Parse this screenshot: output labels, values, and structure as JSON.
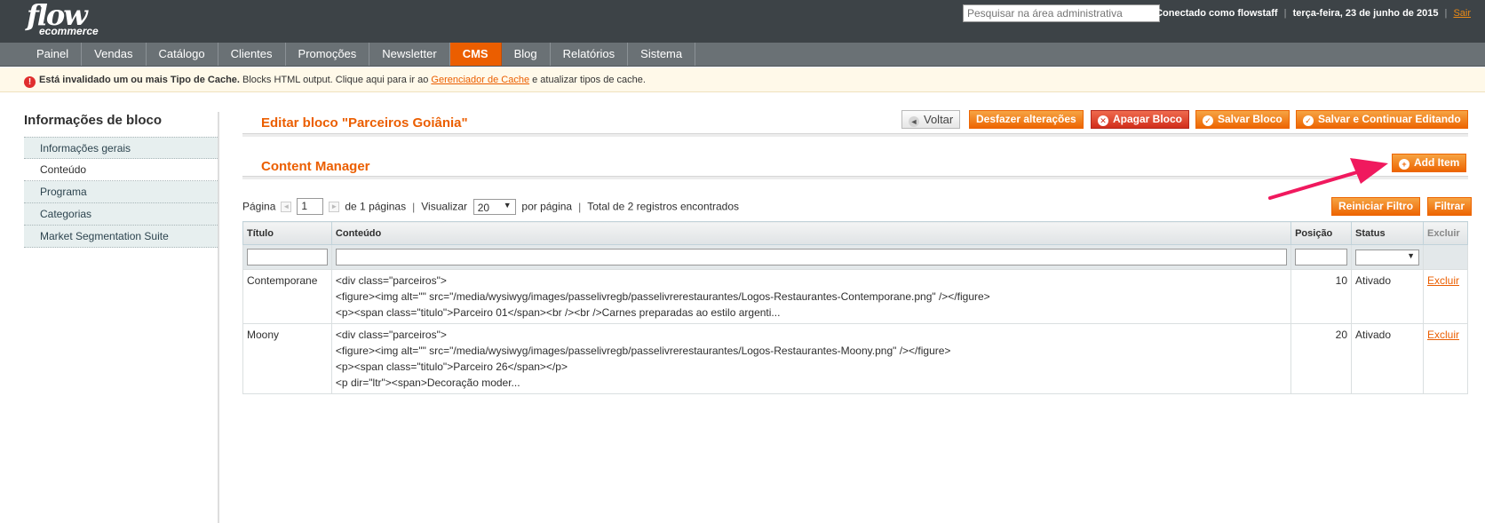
{
  "header": {
    "logo_line1": "flow",
    "logo_line2": "ecommerce",
    "search_placeholder": "Pesquisar na área administrativa",
    "logged_in": "Conectado como flowstaff",
    "date": "terça-feira, 23 de junho de 2015",
    "separator": "|",
    "logout": "Sair"
  },
  "nav": {
    "items": [
      "Painel",
      "Vendas",
      "Catálogo",
      "Clientes",
      "Promoções",
      "Newsletter",
      "CMS",
      "Blog",
      "Relatórios",
      "Sistema"
    ],
    "active": "CMS"
  },
  "notice": {
    "bold": "Está invalidado um ou mais Tipo de Cache.",
    "text1": " Blocks HTML output. Clique aqui para ir ao ",
    "link": "Gerenciador de Cache",
    "text2": " e atualizar tipos de cache."
  },
  "sidebar": {
    "title": "Informações de bloco",
    "tabs": [
      "Informações gerais",
      "Conteúdo",
      "Programa",
      "Categorias",
      "Market Segmentation Suite"
    ],
    "active_tab": "Conteúdo"
  },
  "main": {
    "title": "Editar bloco \"Parceiros Goiânia\"",
    "buttons": {
      "back": "Voltar",
      "reset": "Desfazer alterações",
      "delete": "Apagar Bloco",
      "save": "Salvar Bloco",
      "save_continue": "Salvar e Continuar Editando"
    },
    "section_title": "Content Manager",
    "add_item": "Add Item"
  },
  "pager": {
    "page_label": "Página",
    "page_value": "1",
    "of_pages": "de 1 páginas",
    "pipe": "|",
    "view_label": "Visualizar",
    "per_page": "20",
    "per_page_label": "por página",
    "total": "Total de 2 registros encontrados",
    "reset_filter": "Reiniciar Filtro",
    "filter": "Filtrar"
  },
  "grid": {
    "columns": [
      "Título",
      "Conteúdo",
      "Posição",
      "Status",
      "Excluir"
    ],
    "rows": [
      {
        "title": "Contemporane",
        "content": [
          "<div class=\"parceiros\">",
          "<figure><img alt=\"\" src=\"/media/wysiwyg/images/passelivregb/passelivrerestaurantes/Logos-Restaurantes-Contemporane.png\" /></figure>",
          "<p><span class=\"titulo\">Parceiro 01</span><br /><br />Carnes preparadas ao estilo argenti..."
        ],
        "position": "10",
        "status": "Ativado",
        "delete": "Excluir"
      },
      {
        "title": "Moony",
        "content": [
          "<div class=\"parceiros\">",
          "<figure><img alt=\"\" src=\"/media/wysiwyg/images/passelivregb/passelivrerestaurantes/Logos-Restaurantes-Moony.png\" /></figure>",
          "<p><span class=\"titulo\">Parceiro 26</span></p>",
          "<p dir=\"ltr\"><span>Decoração moder..."
        ],
        "position": "20",
        "status": "Ativado",
        "delete": "Excluir"
      }
    ]
  },
  "colors": {
    "header_bg": "#3d4347",
    "nav_bg": "#6a7175",
    "accent": "#eb5e00",
    "button_orange": "#f18200",
    "button_red": "#d12d1b",
    "annotation_arrow": "#f0195e"
  }
}
